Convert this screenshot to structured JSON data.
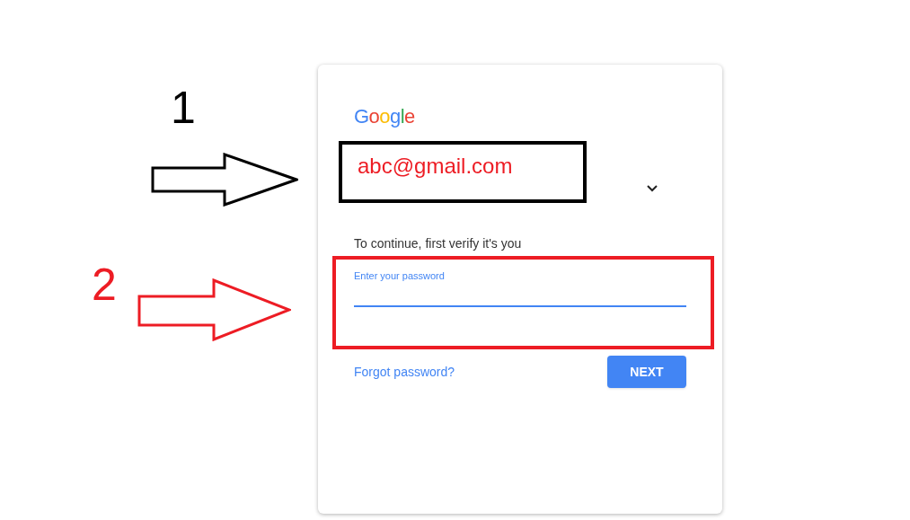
{
  "annotations": [
    {
      "label": "1",
      "color": "#000000"
    },
    {
      "label": "2",
      "color": "#ed1c24"
    }
  ],
  "card": {
    "logo": "Google",
    "account": "abc@gmail.com",
    "prompt": "To continue, first verify it's you",
    "password_field": {
      "label": "Enter your password"
    },
    "forgot_link": "Forgot password?",
    "next_button": "NEXT"
  }
}
